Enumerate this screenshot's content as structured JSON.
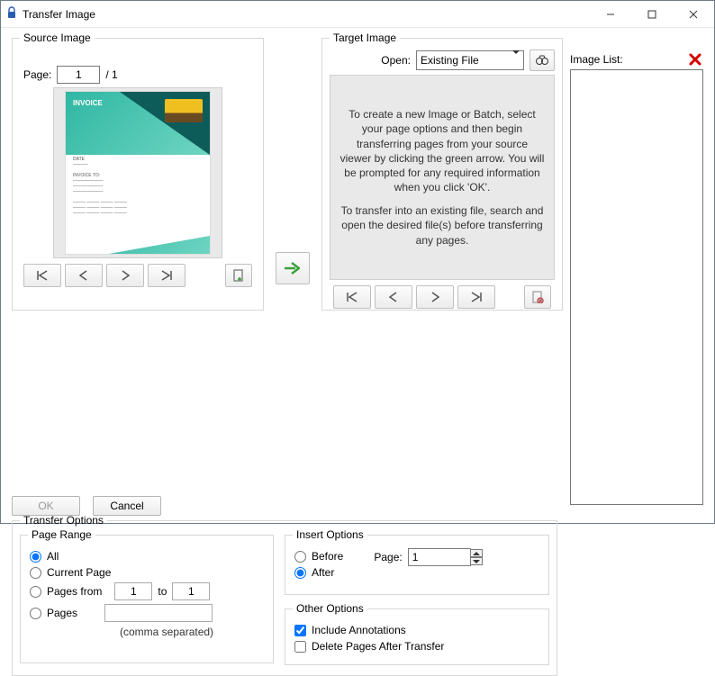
{
  "window": {
    "title": "Transfer Image"
  },
  "source": {
    "legend": "Source Image",
    "page_label": "Page:",
    "page_value": "1",
    "page_total": "/ 1",
    "invoice_label": "INVOICE"
  },
  "target": {
    "legend": "Target Image",
    "open_label": "Open:",
    "open_value": "Existing File",
    "help_p1": "To create a new Image or Batch, select your page options and then begin transferring pages from your source viewer by clicking the green arrow. You will be prompted for any required information when you click 'OK'.",
    "help_p2": "To transfer into an existing file, search and open the desired file(s) before transferring any pages."
  },
  "image_list": {
    "label": "Image List:"
  },
  "transfer_options": {
    "legend": "Transfer Options",
    "page_range": {
      "legend": "Page Range",
      "all": "All",
      "current": "Current Page",
      "from_label": "Pages from",
      "from_val": "1",
      "to_label": "to",
      "to_val": "1",
      "pages_label": "Pages",
      "pages_val": "",
      "hint": "(comma separated)"
    },
    "insert": {
      "legend": "Insert Options",
      "before": "Before",
      "after": "After",
      "page_label": "Page:",
      "page_val": "1"
    },
    "other": {
      "legend": "Other Options",
      "include": "Include Annotations",
      "delete": "Delete Pages After Transfer"
    }
  },
  "buttons": {
    "ok": "OK",
    "cancel": "Cancel"
  }
}
